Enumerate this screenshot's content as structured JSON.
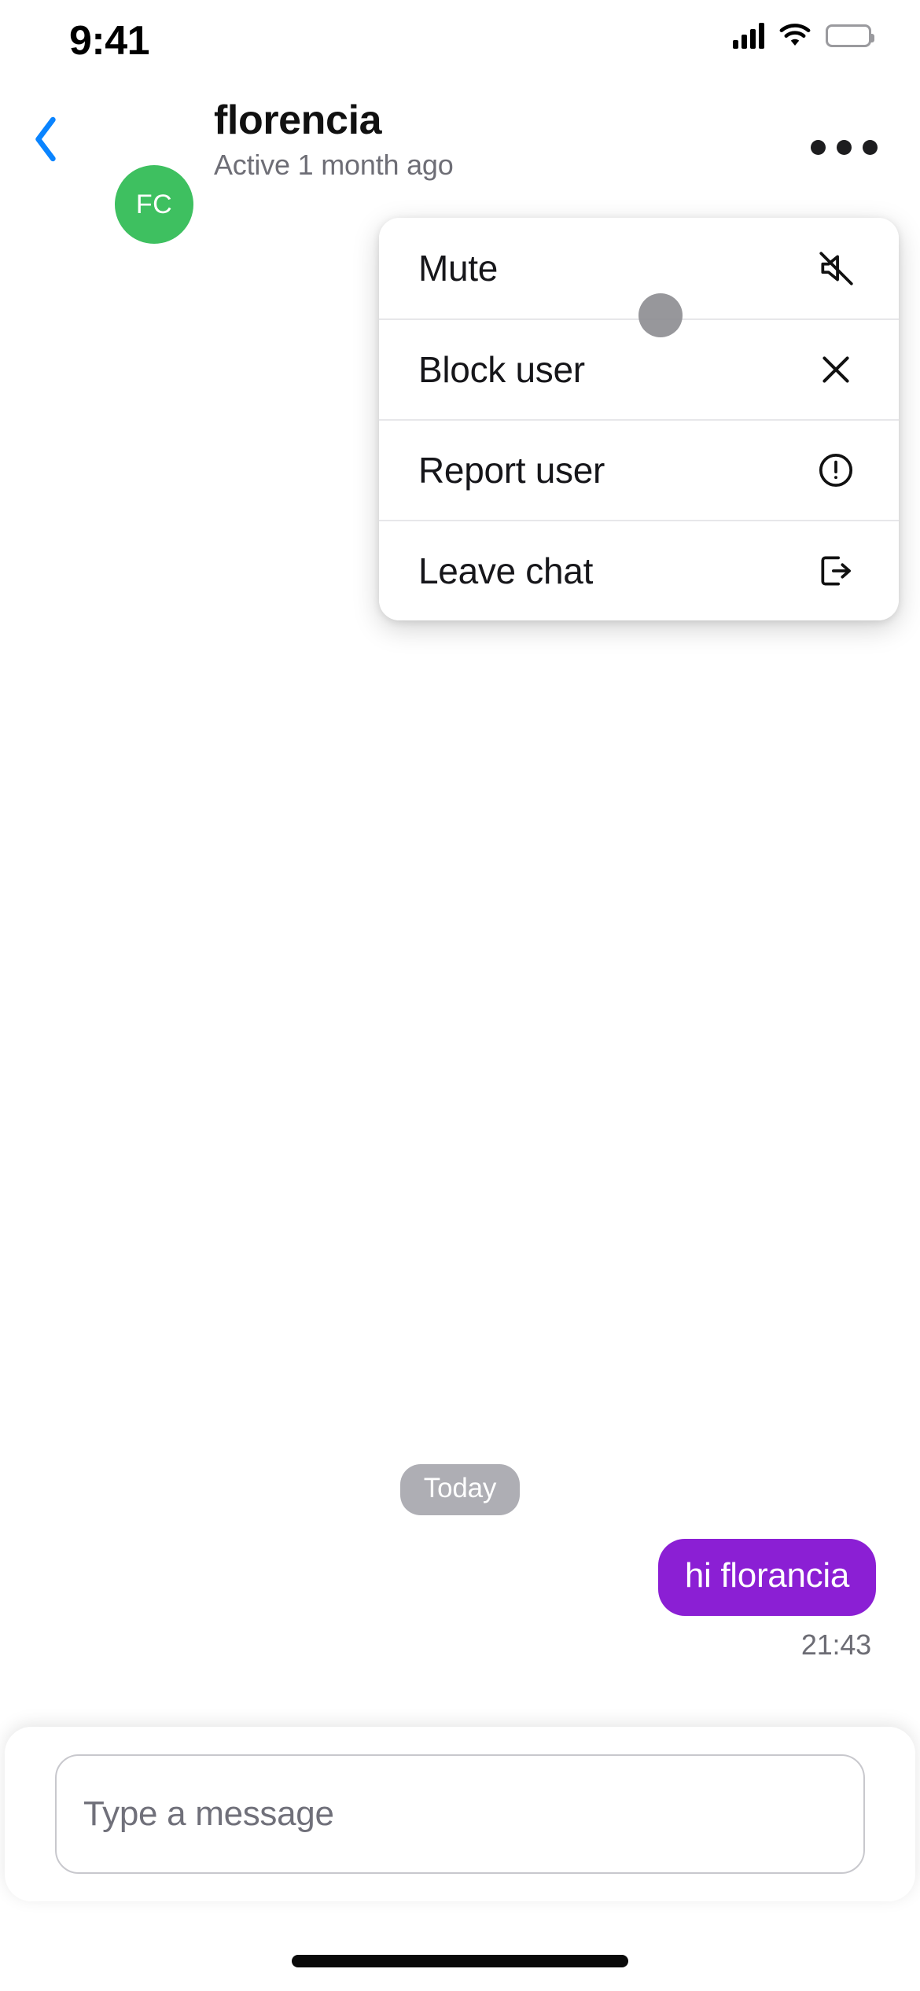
{
  "status_bar": {
    "time": "9:41",
    "signal_icon": "cellular-signal-icon",
    "wifi_icon": "wifi-icon",
    "battery_icon": "battery-full-icon"
  },
  "header": {
    "back_icon": "chevron-left-icon",
    "avatar_initials": "FC",
    "avatar_color": "#3EC060",
    "name": "florencia",
    "status": "Active 1 month ago",
    "more_icon": "more-horizontal-icon"
  },
  "menu": {
    "items": [
      {
        "label": "Mute",
        "icon": "bell-mute-icon"
      },
      {
        "label": "Block user",
        "icon": "close-x-icon"
      },
      {
        "label": "Report user",
        "icon": "alert-circle-icon"
      },
      {
        "label": "Leave chat",
        "icon": "logout-icon"
      }
    ]
  },
  "conversation": {
    "day_separator": "Today",
    "messages": [
      {
        "text": "hi florancia",
        "time": "21:43",
        "direction": "outgoing",
        "bubble_color": "#8B1FD4"
      }
    ]
  },
  "composer": {
    "placeholder": "Type a message",
    "value": ""
  },
  "colors": {
    "accent_purple": "#8B1FD4",
    "avatar_green": "#3EC060",
    "back_blue": "#0A84FF",
    "day_pill_gray": "#AEAEB4"
  }
}
